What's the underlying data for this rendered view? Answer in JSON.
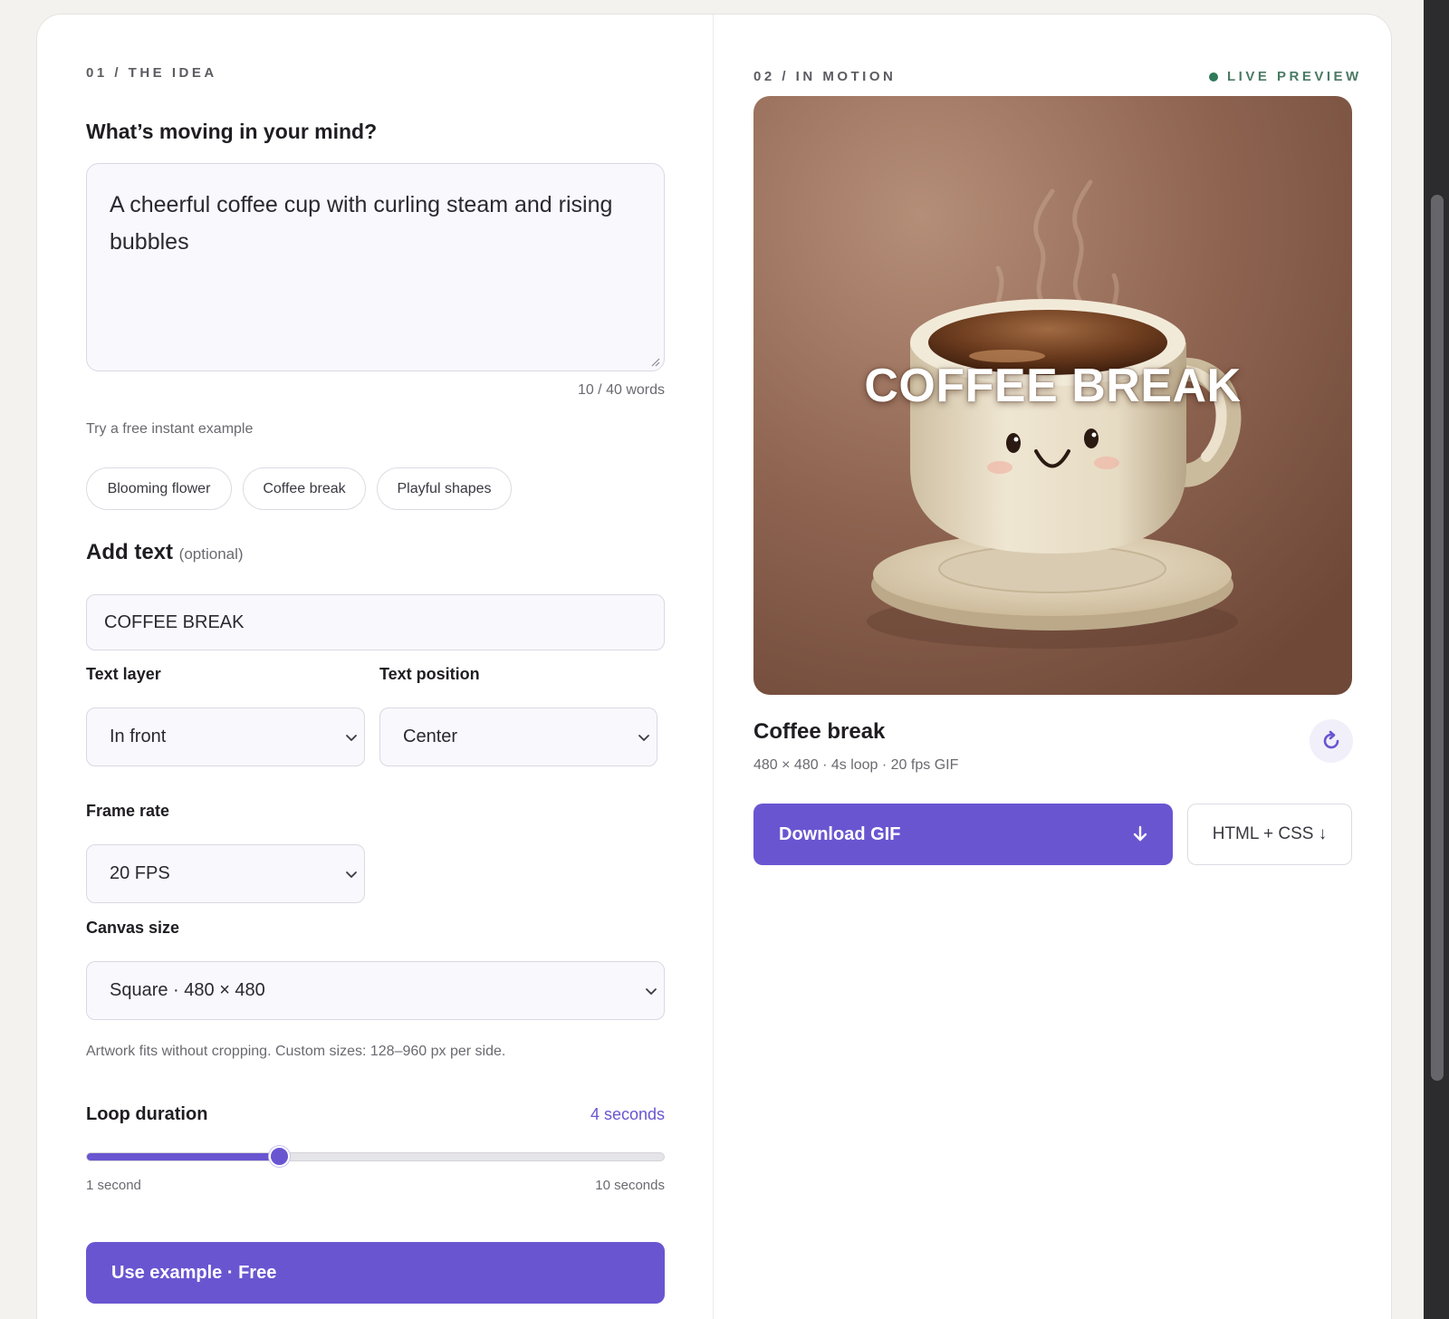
{
  "left": {
    "eyebrow": "01 / THE IDEA",
    "prompt_label": "What’s moving in your mind?",
    "prompt_value": "A cheerful coffee cup with curling steam and rising bubbles",
    "word_count": "10 / 40 words",
    "examples_label": "Try a free instant example",
    "examples": [
      "Blooming flower",
      "Coffee break",
      "Playful shapes"
    ],
    "add_text_label": "Add text",
    "add_text_optional": "(optional)",
    "add_text_value": "COFFEE BREAK",
    "text_layer_label": "Text layer",
    "text_layer_value": "In front",
    "text_position_label": "Text position",
    "text_position_value": "Center",
    "frame_rate_label": "Frame rate",
    "frame_rate_value": "20 FPS",
    "canvas_size_label": "Canvas size",
    "canvas_size_value": "Square · 480 × 480",
    "canvas_hint": "Artwork fits without cropping. Custom sizes: 128–960 px per side.",
    "loop_label": "Loop duration",
    "loop_value_text": "4 seconds",
    "loop_seconds": 4,
    "loop_min_label": "1 second",
    "loop_max_label": "10 seconds",
    "loop_min": 1,
    "loop_max": 10,
    "cta_label": "Use example · Free"
  },
  "right": {
    "eyebrow": "02 / IN MOTION",
    "live_label": "LIVE PREVIEW",
    "overlay_text": "COFFEE BREAK",
    "title": "Coffee break",
    "meta": "480 × 480 · 4s loop · 20 fps GIF",
    "download_label": "Download GIF",
    "html_css_label": "HTML + CSS ↓"
  },
  "colors": {
    "accent": "#6a55d1",
    "live_dot": "#2f7a58",
    "preview_bg": "#8a5f4a"
  },
  "icons": {
    "refresh": "refresh-icon",
    "download": "download-arrow-icon",
    "chevron": "chevron-down-icon"
  }
}
